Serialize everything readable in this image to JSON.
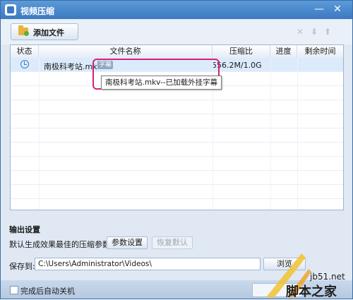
{
  "window": {
    "title": "视频压缩",
    "minimize_icon": "minimize-icon",
    "close_icon": "close-icon"
  },
  "toolbar": {
    "add_file_label": "添加文件",
    "icons": [
      "delete-icon",
      "move-down-icon",
      "move-up-icon"
    ]
  },
  "table": {
    "columns": [
      "状态",
      "文件名称",
      "压缩比",
      "进度",
      "剩余时间"
    ],
    "rows": [
      {
        "status_icon": "clock-icon",
        "name": "南极科考站.mkv",
        "badge": "字幕",
        "ratio": "556.2M/1.0G",
        "progress": "",
        "remaining": ""
      }
    ],
    "empty_rows": 11
  },
  "tooltip": {
    "text": "南极科考站.mkv--已加载外挂字幕"
  },
  "output": {
    "section_title": "输出设置",
    "default_text": "默认生成效果最佳的压缩参数",
    "param_button": "参数设置",
    "restore_button": "恢复默认",
    "save_label": "保存到:",
    "save_path": "C:\\Users\\Administrator\\Videos\\",
    "browse_button": "浏览"
  },
  "footer": {
    "auto_shutdown_label": "完成后自动关机"
  },
  "watermark": {
    "site": "jb51.net",
    "name": "脚本之家"
  },
  "colors": {
    "title_bar": "#3b79c2",
    "highlight": "#d81f7d",
    "selected_row": "#dcebfb"
  }
}
